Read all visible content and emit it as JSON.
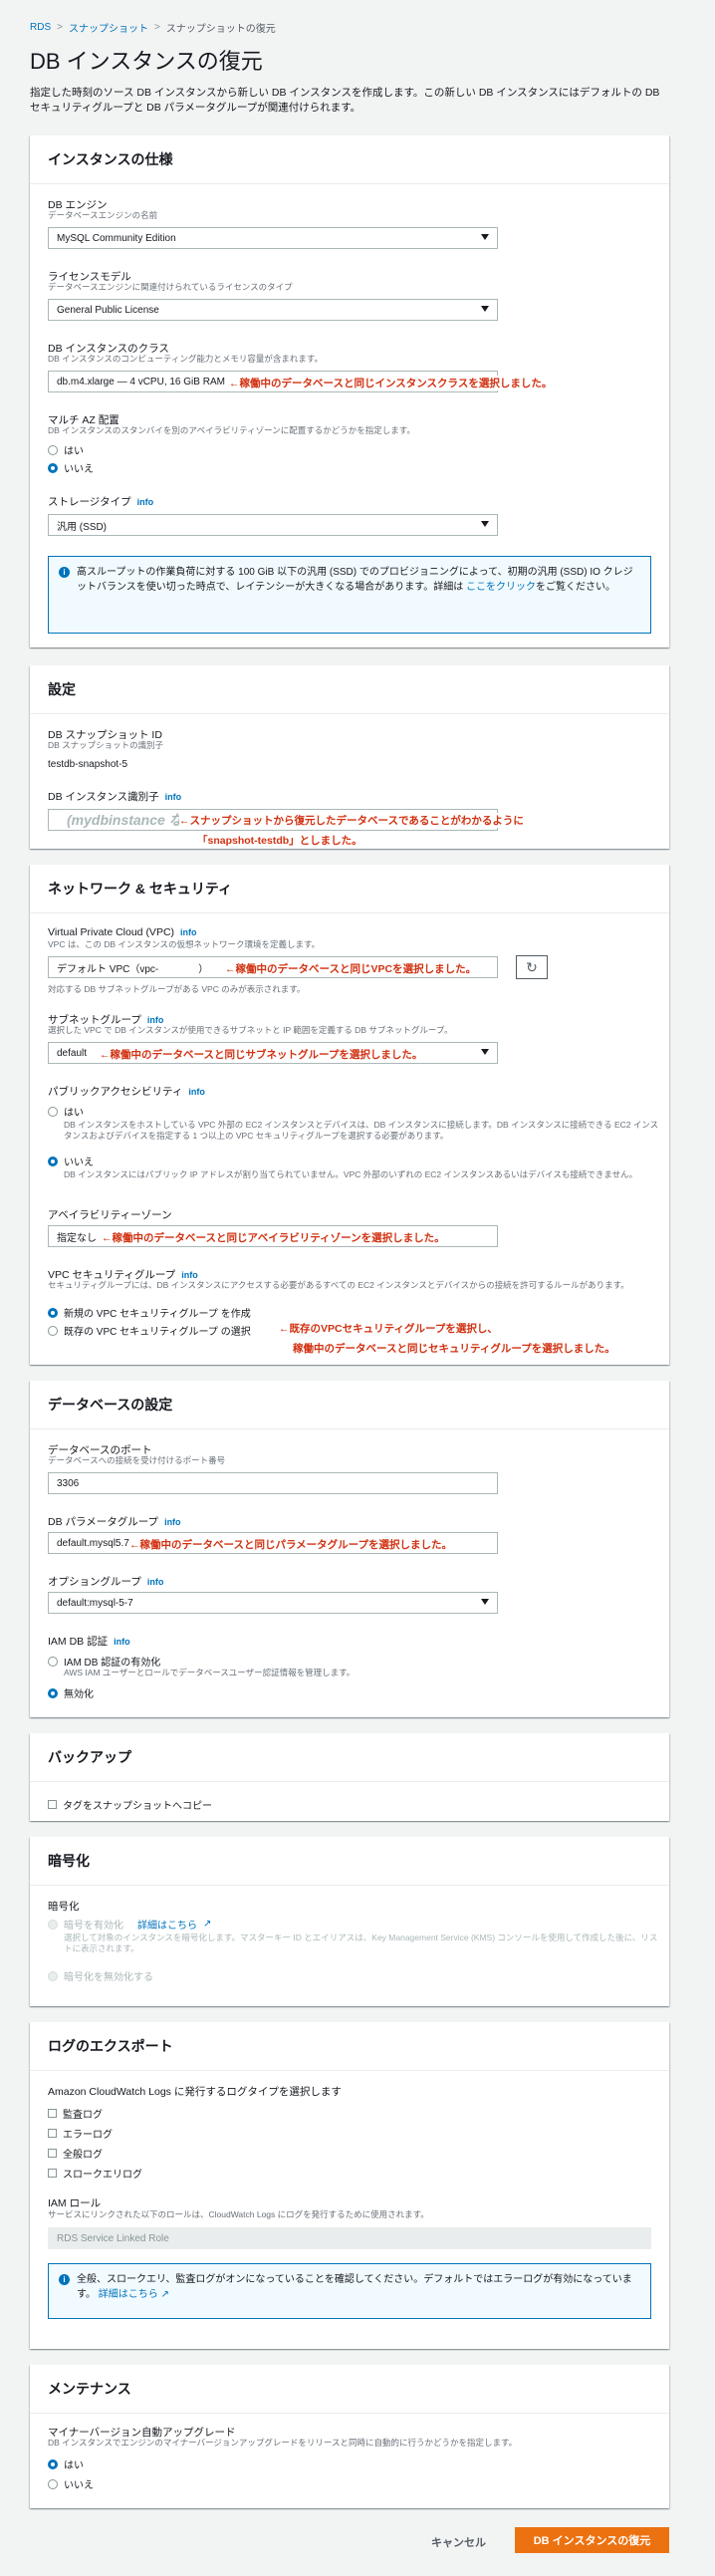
{
  "breadcrumb": {
    "rds": "RDS",
    "snapshots": "スナップショット",
    "current": "スナップショットの復元"
  },
  "page_title": "DB インスタンスの復元",
  "intro": "指定した時刻のソース DB インスタンスから新しい DB インスタンスを作成します。この新しい DB インスタンスにはデフォルトの DB セキュリティグループと DB パラメータグループが関連付けられます。",
  "info_label": "info",
  "spec": {
    "heading": "インスタンスの仕様",
    "engine_label": "DB エンジン",
    "engine_desc": "データベースエンジンの名前",
    "engine_value": "MySQL Community Edition",
    "license_label": "ライセンスモデル",
    "license_desc": "データベースエンジンに関連付けられているライセンスのタイプ",
    "license_value": "General Public License",
    "class_label": "DB インスタンスのクラス",
    "class_desc": "DB インスタンスのコンピューティング能力とメモリ容量が含まれます。",
    "class_value": "db.m4.xlarge — 4 vCPU, 16 GiB RAM",
    "class_note": "←稼働中のデータベースと同じインスタンスクラスを選択しました。",
    "multiaz_label": "マルチ AZ 配置",
    "multiaz_desc": "DB インスタンスのスタンバイを別のアベイラビリティゾーンに配置するかどうかを指定します。",
    "yes": "はい",
    "no": "いいえ",
    "storage_label": "ストレージタイプ",
    "storage_value": "汎用 (SSD)",
    "alert_text": "高スループットの作業負荷に対する 100 GiB 以下の汎用 (SSD) でのプロビジョニングによって、初期の汎用 (SSD) IO クレジットバランスを使い切った時点で、レイテンシーが大きくなる場合があります。詳細は",
    "alert_link": "ここをクリック",
    "alert_tail": "をご覧ください。"
  },
  "settings": {
    "heading": "設定",
    "snapshot_id_label": "DB スナップショット ID",
    "snapshot_id_desc": "DB スナップショットの識別子",
    "snapshot_id_value": "testdb-snapshot-5",
    "identifier_label": "DB インスタンス識別子",
    "identifier_placeholder": "(mydbinstance など)",
    "identifier_note1": "←スナップショットから復元したデータベースであることがわかるように",
    "identifier_note2": "「snapshot-testdb」としました。"
  },
  "network": {
    "heading": "ネットワーク & セキュリティ",
    "vpc_label": "Virtual Private Cloud (VPC)",
    "vpc_desc": "VPC は、この DB インスタンスの仮想ネットワーク環境を定義します。",
    "vpc_value": "デフォルト VPC（vpc-",
    "vpc_value_tail": "）",
    "vpc_note": "←稼働中のデータベースと同じVPCを選択しました。",
    "vpc_hint": "対応する DB サブネットグループがある VPC のみが表示されます。",
    "subnet_label": "サブネットグループ",
    "subnet_desc": "選択した VPC で DB インスタンスが使用できるサブネットと IP 範囲を定義する DB サブネットグループ。",
    "subnet_value": "default",
    "subnet_note": "←稼働中のデータベースと同じサブネットグループを選択しました。",
    "public_label": "パブリックアクセシビリティ",
    "public_yes": "はい",
    "public_yes_desc": "DB インスタンスをホストしている VPC 外部の EC2 インスタンスとデバイスは、DB インスタンスに接続します。DB インスタンスに接続できる EC2 インスタンスおよびデバイスを指定する 1 つ以上の VPC セキュリティグループを選択する必要があります。",
    "public_no": "いいえ",
    "public_no_desc": "DB インスタンスにはパブリック IP アドレスが割り当てられていません。VPC 外部のいずれの EC2 インスタンスあるいはデバイスも接続できません。",
    "az_label": "アベイラビリティーゾーン",
    "az_value": "指定なし",
    "az_note": "←稼働中のデータベースと同じアベイラビリティゾーンを選択しました。",
    "sg_label": "VPC セキュリティグループ",
    "sg_desc": "セキュリティグループには、DB インスタンスにアクセスする必要があるすべての EC2 インスタンスとデバイスからの接続を許可するルールがあります。",
    "sg_new": "新規の VPC セキュリティグループ を作成",
    "sg_existing": "既存の VPC セキュリティグループ の選択",
    "sg_note1": "←既存のVPCセキュリティグループを選択し、",
    "sg_note2": "稼働中のデータベースと同じセキュリティグループを選択しました。"
  },
  "database": {
    "heading": "データベースの設定",
    "port_label": "データベースのポート",
    "port_desc": "データベースへの接続を受け付けるポート番号",
    "port_value": "3306",
    "param_label": "DB パラメータグループ",
    "param_value": "default.mysql5.7",
    "param_note": "←稼働中のデータベースと同じパラメータグループを選択しました。",
    "option_label": "オプショングループ",
    "option_value": "default:mysql-5-7",
    "iam_label": "IAM DB 認証",
    "iam_enable": "IAM DB 認証の有効化",
    "iam_enable_desc": "AWS IAM ユーザーとロールでデータベースユーザー認証情報を管理します。",
    "iam_disable": "無効化"
  },
  "backup": {
    "heading": "バックアップ",
    "copy_tags": "タグをスナップショットへコピー"
  },
  "encryption": {
    "heading": "暗号化",
    "label": "暗号化",
    "enable": "暗号を有効化",
    "link": "詳細はこちら",
    "enable_desc": "選択して対象のインスタンスを暗号化します。マスターキー ID とエイリアスは、Key Management Service (KMS) コンソールを使用して作成した後に、リストに表示されます。",
    "disable": "暗号化を無効化する"
  },
  "logs": {
    "heading": "ログのエクスポート",
    "desc": "Amazon CloudWatch Logs に発行するログタイプを選択します",
    "items": [
      "監査ログ",
      "エラーログ",
      "全般ログ",
      "スロークエリログ"
    ],
    "iam_role_label": "IAM ロール",
    "iam_role_desc": "サービスにリンクされた以下のロールは、CloudWatch Logs にログを発行するために使用されます。",
    "iam_role_value": "RDS Service Linked Role",
    "alert_text": "全般、スロークエリ、監査ログがオンになっていることを確認してください。デフォルトではエラーログが有効になっています。",
    "alert_link": "詳細はこちら"
  },
  "maintenance": {
    "heading": "メンテナンス",
    "minor_label": "マイナーバージョン自動アップグレード",
    "minor_desc": "DB インスタンスでエンジンのマイナーバージョンアップグレードをリリースと同時に自動的に行うかどうかを指定します。",
    "yes": "はい",
    "no": "いいえ"
  },
  "actions": {
    "cancel": "キャンセル",
    "submit": "DB インスタンスの復元"
  }
}
